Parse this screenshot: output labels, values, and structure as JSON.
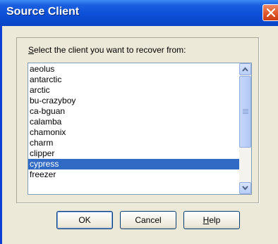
{
  "window": {
    "title": "Source Client"
  },
  "dialog": {
    "prompt": "Select the client you want to recover from:",
    "clients": [
      "aeolus",
      "antarctic",
      "arctic",
      "bu-crazyboy",
      "ca-bguan",
      "calamba",
      "chamonix",
      "charm",
      "clipper",
      "cypress",
      "freezer"
    ],
    "selected_client": "cypress"
  },
  "buttons": {
    "ok": "OK",
    "cancel": "Cancel",
    "help": "Help"
  },
  "colors": {
    "titlebar": "#0c4fd8",
    "selection": "#316ac5",
    "close": "#e35a2e",
    "dialog_bg": "#ece9d8"
  }
}
